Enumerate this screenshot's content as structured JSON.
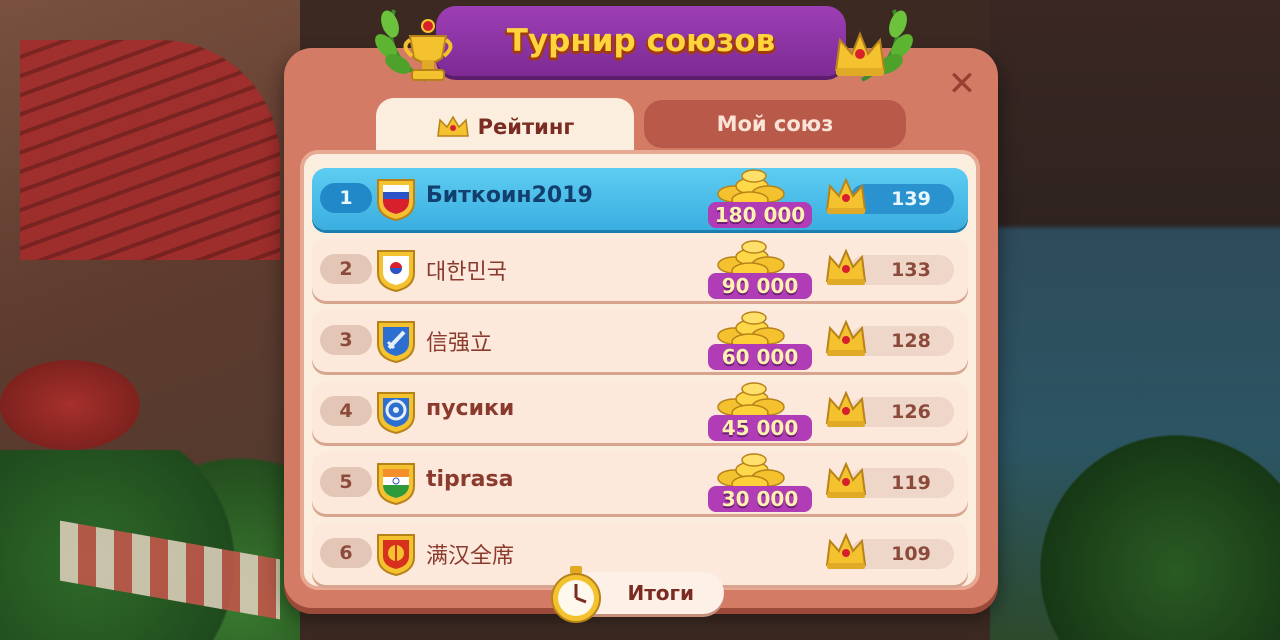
{
  "dialog": {
    "title": "Турнир союзов",
    "close_label": "✕"
  },
  "tabs": [
    {
      "label": "Рейтинг",
      "active": true
    },
    {
      "label": "Мой союз",
      "active": false
    }
  ],
  "leaderboard": [
    {
      "rank": "1",
      "name": "Биткоин2019",
      "emblem": "flag-russia",
      "reward": "180 000",
      "score": "139",
      "highlight": true
    },
    {
      "rank": "2",
      "name": "대한민국",
      "emblem": "flag-south-korea",
      "reward": "90 000",
      "score": "133"
    },
    {
      "rank": "3",
      "name": "信强立",
      "emblem": "sword-emblem",
      "reward": "60 000",
      "score": "128"
    },
    {
      "rank": "4",
      "name": "пусики",
      "emblem": "target-emblem",
      "reward": "45 000",
      "score": "126"
    },
    {
      "rank": "5",
      "name": "tiprasa",
      "emblem": "flag-india",
      "reward": "30 000",
      "score": "119"
    },
    {
      "rank": "6",
      "name": "满汉全席",
      "emblem": "fruit-emblem",
      "reward": "",
      "score": "109"
    }
  ],
  "footer": {
    "results_label": "Итоги"
  },
  "colors": {
    "panel": "#d47b66",
    "banner": "#8f35a6",
    "highlight_row": "#4bbcea",
    "reward_tag": "#b03cb6",
    "gold": "#ffcc2e"
  }
}
